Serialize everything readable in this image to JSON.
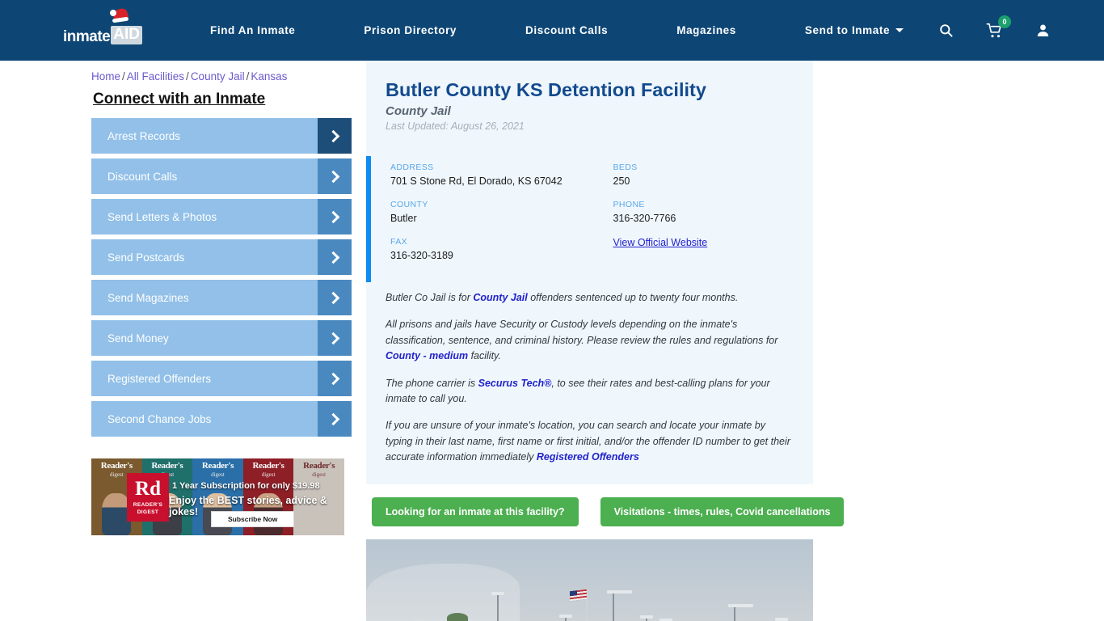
{
  "header": {
    "logo": {
      "text": "inmate",
      "badge": "AID",
      "hat_icon": "santa-hat-icon"
    },
    "nav": [
      {
        "label": "Find An Inmate",
        "dropdown": false
      },
      {
        "label": "Prison Directory",
        "dropdown": false
      },
      {
        "label": "Discount Calls",
        "dropdown": false
      },
      {
        "label": "Magazines",
        "dropdown": false
      },
      {
        "label": "Send to Inmate",
        "dropdown": true
      }
    ],
    "icons": {
      "search": "search-icon",
      "cart": "cart-icon",
      "cart_count": "0",
      "account": "user-account-icon"
    },
    "bg_color": "#0d4675"
  },
  "breadcrumb": {
    "items": [
      "Home",
      "All Facilities",
      "County Jail",
      "Kansas"
    ],
    "separator": "/"
  },
  "sidebar": {
    "title": "Connect with an Inmate",
    "items": [
      {
        "label": "Arrest Records",
        "active": true
      },
      {
        "label": "Discount Calls",
        "active": false
      },
      {
        "label": "Send Letters & Photos",
        "active": false
      },
      {
        "label": "Send Postcards",
        "active": false
      },
      {
        "label": "Send Magazines",
        "active": false
      },
      {
        "label": "Send Money",
        "active": false
      },
      {
        "label": "Registered Offenders",
        "active": false
      },
      {
        "label": "Second Chance Jobs",
        "active": false
      }
    ],
    "button_color": "#92c0e8",
    "arrow_color": "#4a89c0",
    "arrow_active_color": "#1d4e79"
  },
  "ad": {
    "brand": "Rd",
    "brand_name": "READER'S DIGEST",
    "line1": "1 Year Subscription for only $19.98",
    "line2": "Enjoy the BEST stories, advice & jokes!",
    "cta": "Subscribe Now",
    "covers": [
      {
        "title": "Reader's",
        "sub": "digest"
      },
      {
        "title": "Reader's",
        "sub": "digest"
      },
      {
        "title": "Reader's",
        "sub": "digest"
      },
      {
        "title": "Reader's",
        "sub": "digest"
      },
      {
        "title": "Reader's",
        "sub": "digest"
      }
    ]
  },
  "facility": {
    "name": "Butler County KS Detention Facility",
    "type": "County Jail",
    "last_updated": "Last Updated: August 26, 2021",
    "fields": {
      "address_label": "ADDRESS",
      "address_value": "701 S Stone Rd, El Dorado, KS 67042",
      "county_label": "COUNTY",
      "county_value": "Butler",
      "fax_label": "FAX",
      "fax_value": "316-320-3189",
      "beds_label": "BEDS",
      "beds_value": "250",
      "phone_label": "PHONE",
      "phone_value": "316-320-7766",
      "website_link": "View Official Website"
    },
    "paragraphs": {
      "p1_a": "Butler Co Jail is for ",
      "p1_link": "County Jail",
      "p1_b": " offenders sentenced up to twenty four months.",
      "p2_a": "All prisons and jails have Security or Custody levels depending on the inmate's classification, sentence, and criminal history. Please review the rules and regulations for ",
      "p2_link": "County - medium",
      "p2_b": " facility.",
      "p3_a": "The phone carrier is ",
      "p3_link": "Securus Tech®",
      "p3_b": ", to see their rates and best-calling plans for your inmate to call you.",
      "p4_a": "If you are unsure of your inmate's location, you can search and locate your inmate by typing in their last name, first name or first initial, and/or the offender ID number to get their accurate information immediately ",
      "p4_link": "Registered Offenders"
    },
    "actions": [
      {
        "label": "Looking for an inmate at this facility?"
      },
      {
        "label": "Visitations - times, rules, Covid cancellations"
      }
    ],
    "accent_color": "#0d8bf2",
    "panel_bg": "#eff7fd",
    "action_color": "#4caf50"
  },
  "photo": {
    "alt_name": "facility-exterior-photo"
  }
}
